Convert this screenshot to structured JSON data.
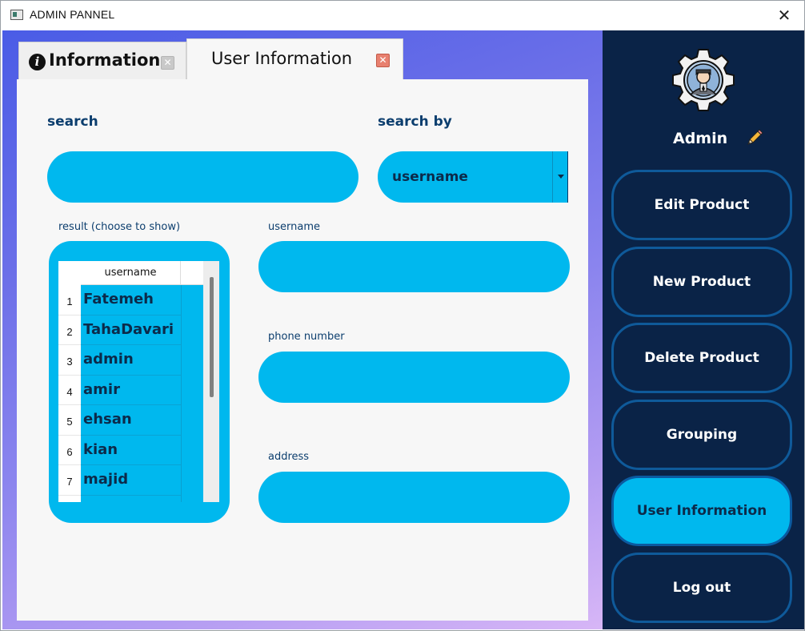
{
  "window": {
    "title": "ADMIN PANNEL",
    "close_glyph": "✕"
  },
  "tabs": [
    {
      "label": "Information",
      "icon": "info-icon",
      "close_glyph": "✕"
    },
    {
      "label": "User Information",
      "close_glyph": "✕",
      "selected": true
    }
  ],
  "form": {
    "search_label": "search",
    "search_value": "",
    "search_by_label": "search by",
    "search_by_value": "username",
    "result_label": "result (choose to show)",
    "username_label": "username",
    "username_value": "",
    "phone_label": "phone number",
    "phone_value": "",
    "address_label": "address",
    "address_value": ""
  },
  "table": {
    "column_header": "username",
    "rows": [
      {
        "num": "1",
        "username": "Fatemeh"
      },
      {
        "num": "2",
        "username": "TahaDavari"
      },
      {
        "num": "3",
        "username": "admin"
      },
      {
        "num": "4",
        "username": "amir"
      },
      {
        "num": "5",
        "username": "ehsan"
      },
      {
        "num": "6",
        "username": "kian"
      },
      {
        "num": "7",
        "username": "majid"
      }
    ]
  },
  "sidebar": {
    "user_name": "Admin",
    "avatar_icon": "admin-avatar-icon",
    "edit_icon": "pencil-icon",
    "buttons": [
      {
        "label": "Edit Product"
      },
      {
        "label": "New Product"
      },
      {
        "label": "Delete Product"
      },
      {
        "label": "Grouping"
      },
      {
        "label": "User Information",
        "active": true
      },
      {
        "label": "Log out"
      }
    ]
  },
  "colors": {
    "accent": "#00b8ee",
    "sidebar_bg": "#0a2347",
    "label_text": "#0c3e6e"
  }
}
